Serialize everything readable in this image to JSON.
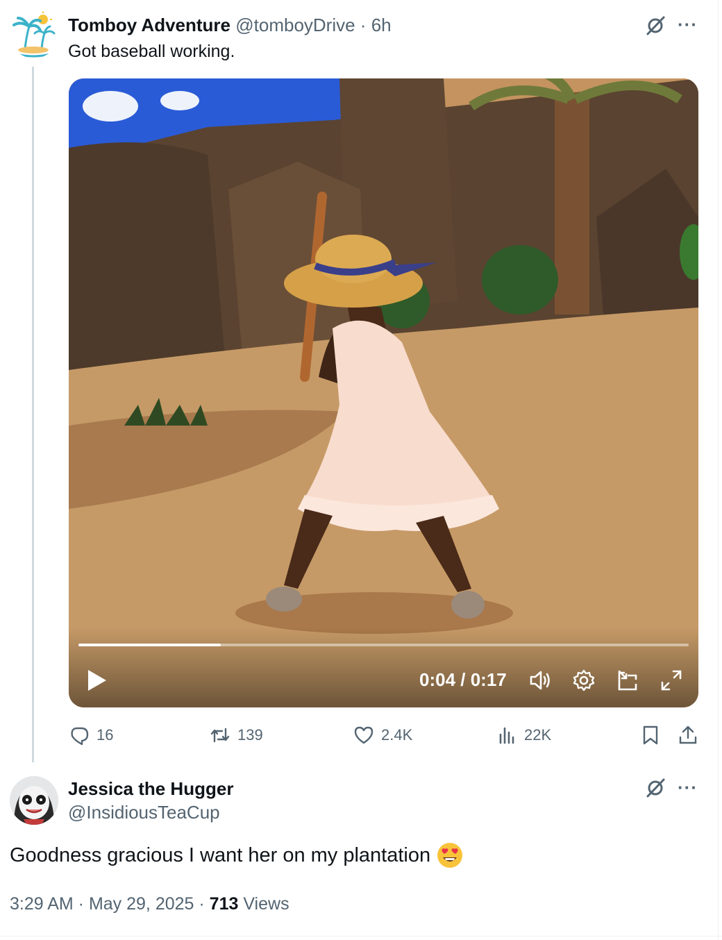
{
  "tweet1": {
    "display_name": "Tomboy Adventure",
    "handle": "@tomboyDrive",
    "separator": " · ",
    "time_ago": "6h",
    "text": "Got baseball working.",
    "avatar_icon": "palm-island-icon",
    "video": {
      "timecode": "0:04 / 0:17",
      "progress": 0.233,
      "play_icon": "play-icon",
      "volume_icon": "volume-icon",
      "settings_icon": "gear-icon",
      "pip_icon": "picture-in-picture-icon",
      "fullscreen_icon": "fullscreen-icon"
    },
    "actions": {
      "replies": "16",
      "reposts": "139",
      "likes": "2.4K",
      "views": "22K"
    }
  },
  "tweet2": {
    "display_name": "Jessica the Hugger",
    "handle": "@InsidiousTeaCup",
    "text": "Goodness gracious I want her on my plantation",
    "emoji": "heart-eyes-emoji",
    "time": "3:29 AM",
    "separator": " · ",
    "date": "May 29, 2025",
    "views_count": "713",
    "views_label": " Views"
  },
  "colors": {
    "text_primary": "#0f1419",
    "text_muted": "#536471",
    "thread_line": "#cfd9de"
  }
}
